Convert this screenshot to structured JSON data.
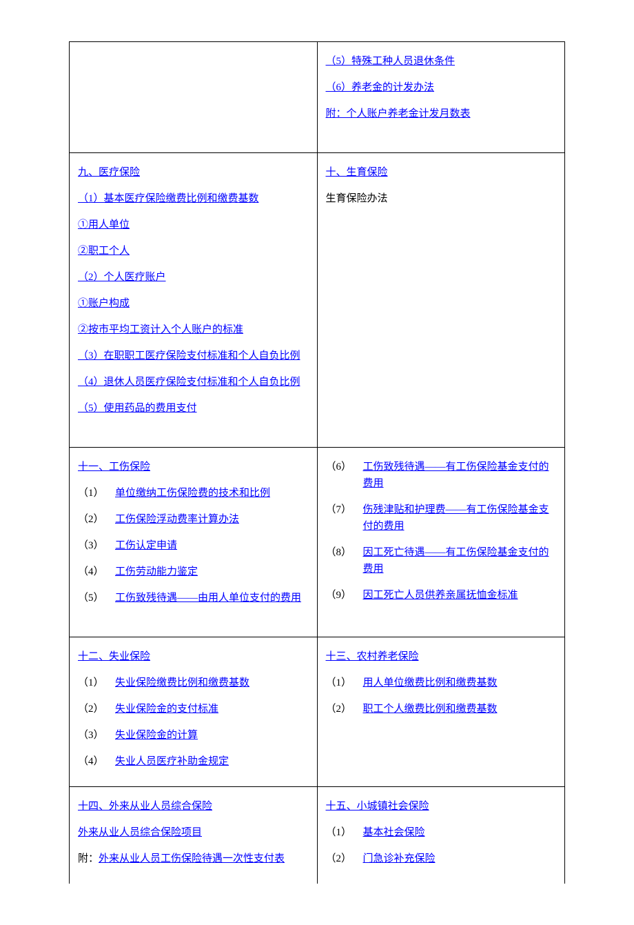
{
  "cells": {
    "r1c1": [],
    "r1c2": [
      {
        "text": "（5）特殊工种人员退休条件",
        "link": true
      },
      {
        "text": "（6）养老金的计发办法",
        "link": true
      },
      {
        "text": "附：个人账户养老金计发月数表",
        "link": true
      }
    ],
    "r2c1": [
      {
        "text": "九、医疗保险",
        "link": true
      },
      {
        "text": "（1）基本医疗保险缴费比例和缴费基数",
        "link": true
      },
      {
        "text": "①用人单位",
        "link": true
      },
      {
        "text": "②职工个人",
        "link": true
      },
      {
        "text": "（2）个人医疗账户",
        "link": true
      },
      {
        "text": "①账户构成",
        "link": true
      },
      {
        "text": "②按市平均工资计入个人账户的标准",
        "link": true
      },
      {
        "text": "（3）在职职工医疗保险支付标准和个人自负比例",
        "link": true
      },
      {
        "text": "（4）退休人员医疗保险支付标准和个人自负比例",
        "link": true
      },
      {
        "text": "（5）使用药品的费用支付",
        "link": true
      }
    ],
    "r2c2": [
      {
        "text": "十、生育保险",
        "link": true
      },
      {
        "text": "生育保险办法",
        "link": false
      }
    ],
    "r3c1": [
      {
        "text": "十一、工伤保险",
        "link": true
      },
      {
        "num": "（1）",
        "text": "单位缴纳工伤保险费的技术和比例",
        "link": true
      },
      {
        "num": "（2）",
        "text": "工伤保险浮动费率计算办法",
        "link": true
      },
      {
        "num": "（3）",
        "text": "工伤认定申请",
        "link": true
      },
      {
        "num": "（4）",
        "text": "工伤劳动能力鉴定",
        "link": true
      },
      {
        "num": "（5）",
        "text": "工伤致残待遇——由用人单位支付的费用",
        "link": true
      }
    ],
    "r3c2": [
      {
        "num": "（6）",
        "text": "工伤致残待遇——有工伤保险基金支付的费用",
        "link": true
      },
      {
        "num": "（7）",
        "text": "伤残津贴和护理费——有工伤保险基金支付的费用",
        "link": true
      },
      {
        "num": "（8）",
        "text": "因工死亡待遇——有工伤保险基金支付的费用",
        "link": true
      },
      {
        "num": "（9）",
        "text": "因工死亡人员供养亲属抚恤金标准",
        "link": true
      }
    ],
    "r4c1": [
      {
        "text": "十二、失业保险",
        "link": true
      },
      {
        "num": "（1）",
        "text": "失业保险缴费比例和缴费基数",
        "link": true
      },
      {
        "num": "（2）",
        "text": "失业保险金的支付标准",
        "link": true
      },
      {
        "num": "（3）",
        "text": "失业保险金的计算",
        "link": true
      },
      {
        "num": "（4）",
        "text": "失业人员医疗补助金规定",
        "link": true
      }
    ],
    "r4c2": [
      {
        "text": "十三、农村养老保险",
        "link": true
      },
      {
        "num": "（1）",
        "text": "用人单位缴费比例和缴费基数",
        "link": true
      },
      {
        "num": "（2）",
        "text": "职工个人缴费比例和缴费基数",
        "link": true
      }
    ],
    "r5c1": [
      {
        "text": "十四、外来从业人员综合保险",
        "link": true
      },
      {
        "text": "外来从业人员综合保险项目",
        "link": true
      },
      {
        "prefix": "附：",
        "text": "外来从业人员工伤保险待遇一次性支付表",
        "link": true
      }
    ],
    "r5c2": [
      {
        "text": "十五、小城镇社会保险",
        "link": true
      },
      {
        "num": "（1）",
        "text": "基本社会保险",
        "link": true
      },
      {
        "num": "（2）",
        "text": "门急诊补充保险",
        "link": true
      }
    ]
  }
}
